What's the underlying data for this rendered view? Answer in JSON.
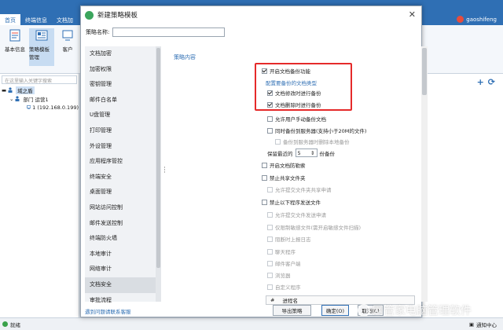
{
  "app": {
    "tabs": [
      "首页",
      "终端信息",
      "文档加"
    ],
    "user": "gaoshifeng",
    "ribbon": [
      "基本信息",
      "策略模板管理",
      "客户"
    ],
    "sidebar": {
      "search_placeholder": "在这里输入关键字搜索",
      "tree": {
        "root": "域之盾",
        "dept": "部门 运营1",
        "pc": "1 (192.168.0.199)"
      }
    },
    "status": "就绪",
    "notify": "通知中心"
  },
  "dialog": {
    "title": "新建策略模板",
    "name_label": "策略名称:",
    "name_value": "",
    "nav": [
      "文档加密",
      "加密权限",
      "密钥管理",
      "邮件白名单",
      "U盘管理",
      "打印管理",
      "外设管理",
      "应用程序管控",
      "终端安全",
      "桌面管理",
      "网站访问控制",
      "邮件发送控制",
      "终端防火墙",
      "本地审计",
      "网络审计",
      "文档安全",
      "审批流程"
    ],
    "active_nav": 15,
    "section_title": "策略内容",
    "options": {
      "enable_backup": "开启文档备份功能",
      "config_types": "配置要备份的文档类型",
      "backup_on_modify": "文档修改时进行备份",
      "backup_on_delete": "文档删除时进行备份",
      "allow_user_backup": "允许用户手动备份文档",
      "sync_server": "同时备份到服务器(支持小于20M的文件)",
      "delete_local": "备份到服务器时删除本地备份",
      "keep_prefix": "保留最近的",
      "keep_value": "5",
      "keep_suffix": "份备份",
      "enable_watermark": "开启文档防勒索",
      "forbid_share": "禁止共享文件夹",
      "allow_share_apply": "允许提交文件夹共享申请",
      "forbid_send": "禁止以下程序发送文件",
      "allow_send_apply": "允许提交文件发送申请",
      "only_encrypted": "仅限制敏感文件(需开启敏感文件扫描)",
      "block_upload": "阻断时上报日志",
      "chat": "聊天程序",
      "mail_client": "邮件客户端",
      "browser": "浏览器",
      "custom": "自定义程序"
    },
    "table_headers": [
      "#",
      "进程名"
    ],
    "help_link": "遇到问题请联系客服",
    "export_label": "导出策略",
    "ok_label": "确定(O)",
    "cancel_label": "取消(C)"
  },
  "watermark": "网管家电脑管理软件",
  "colors": {
    "accent": "#2f6fb4",
    "highlight": "#e52a2a",
    "titlebar": "#2f6fb4"
  }
}
